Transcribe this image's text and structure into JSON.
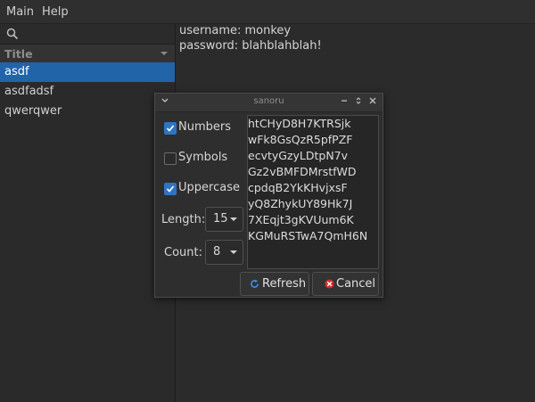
{
  "menu": {
    "main": "Main",
    "help": "Help"
  },
  "sidebar": {
    "search_placeholder": "",
    "column_title": "Title",
    "items": [
      {
        "label": "asdf",
        "selected": true
      },
      {
        "label": "asdfadsf",
        "selected": false
      },
      {
        "label": "qwerqwer",
        "selected": false
      }
    ]
  },
  "main": {
    "lines": [
      "username: monkey",
      "password: blahblahblah!"
    ]
  },
  "dialog": {
    "title": "sanoru",
    "options": {
      "numbers": {
        "label": "Numbers",
        "checked": true
      },
      "symbols": {
        "label": "Symbols",
        "checked": false
      },
      "uppercase": {
        "label": "Uppercase",
        "checked": true
      }
    },
    "length": {
      "label": "Length:",
      "value": "15"
    },
    "count": {
      "label": "Count:",
      "value": "8"
    },
    "passwords": [
      "htCHyD8H7KTRSjk",
      "wFk8GsQzR5pfPZF",
      "ecvtyGzyLDtpN7v",
      "Gz2vBMFDMrstfWD",
      "cpdqB2YkKHvjxsF",
      "yQ8ZhykUY89Hk7J",
      "7XEqjt3gKVUum6K",
      "KGMuRSTwA7QmH6N"
    ],
    "refresh_label": "Refresh",
    "cancel_label": "Cancel"
  },
  "colors": {
    "accent": "#2164a8",
    "cancel": "#d03030",
    "refresh": "#3d8be0"
  }
}
